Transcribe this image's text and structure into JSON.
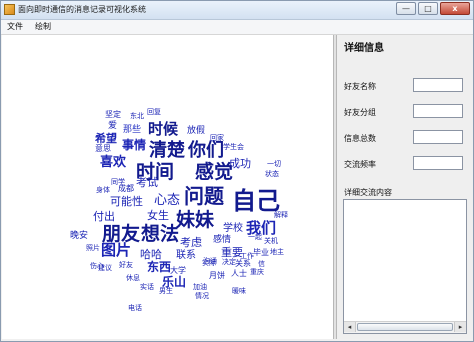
{
  "window": {
    "title": "面向即时通信的消息记录可视化系统",
    "buttons": {
      "minimize": "—",
      "maximize": "□",
      "close": "x"
    }
  },
  "menu": {
    "file": "文件",
    "draw": "绘制"
  },
  "wordcloud": {
    "words": [
      "坚定",
      "东北",
      "回复",
      "爱",
      "那些",
      "放假",
      "希望",
      "时候",
      "回家",
      "意思",
      "事情",
      "清楚",
      "你们",
      "学生会",
      "喜欢",
      "成功",
      "一切",
      "时间",
      "感觉",
      "状态",
      "身体",
      "成都",
      "考试",
      "可能性",
      "心态",
      "问题",
      "自己",
      "解释",
      "女生",
      "学校",
      "我们",
      "付出",
      "妹妹",
      "晚安",
      "朋友",
      "想法",
      "考虑",
      "感情",
      "关机",
      "图片",
      "哈哈",
      "联系",
      "重要",
      "毕业",
      "地主",
      "伤心",
      "好友",
      "东西",
      "实际",
      "大学",
      "关系",
      "建议",
      "乐山",
      "月饼",
      "人士",
      "休息",
      "加油",
      "沟通",
      "实话",
      "男生",
      "情况",
      "电话",
      "暖味",
      "决定",
      "一起",
      "同学",
      "照片",
      "工作",
      "信",
      "重庆"
    ]
  },
  "panel": {
    "title": "详细信息",
    "friend_name_label": "好友名称",
    "friend_group_label": "好友分组",
    "message_total_label": "信息总数",
    "frequency_label": "交流频率",
    "detail_label": "详细交流内容",
    "friend_name_value": "",
    "friend_group_value": "",
    "message_total_value": "",
    "frequency_value": ""
  },
  "scroll": {
    "left": "◂",
    "right": "▸"
  }
}
